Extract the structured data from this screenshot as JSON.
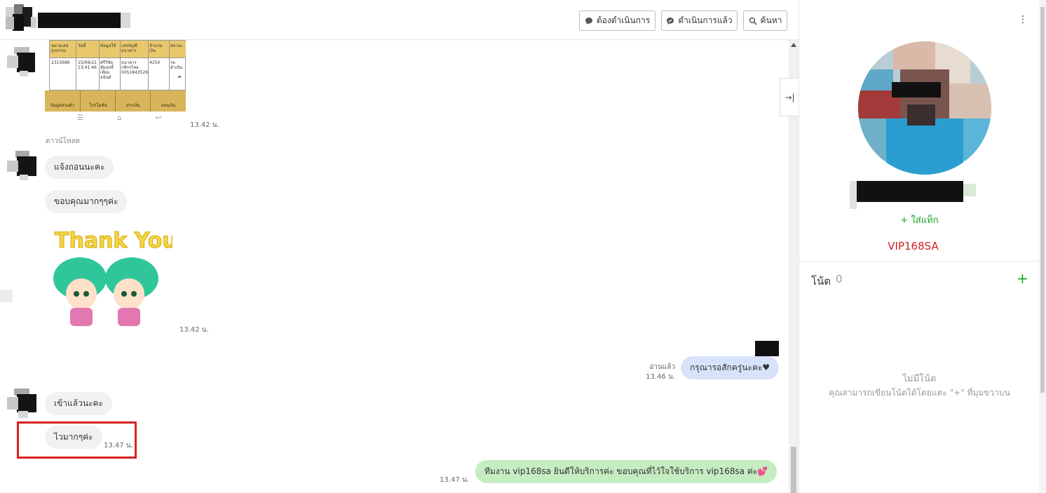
{
  "header": {
    "buttons": {
      "todo_label": "ต้องดำเนินการ",
      "done_label": "ดำเนินการแล้ว",
      "search_label": "ค้นหา"
    }
  },
  "chat": {
    "download_label": "ดาวน์โหลด",
    "screenshot_table": {
      "header_cells": [
        "หมายเลขธุรกรรม",
        "วันที่",
        "ข้อมูลใช้",
        "เลขบัญชีธนาคาร",
        "จำนวนเงิน",
        "สถานะ"
      ],
      "row_cells": [
        "2315686",
        "15/06/21 13:41:46",
        "ศรีวิชัย สัมฤทธิ์ เที่ยม อนันต์",
        "ธนาคาร กสิกรไทย 0051843526",
        "4250",
        "รอดำเนิน"
      ],
      "bottom_bar": [
        "ข้อมูลส่วนตัว",
        "โปรโมชั่น",
        "ฝากเงิน",
        "ถอนเงิน"
      ]
    },
    "messages": [
      {
        "id": "m1",
        "side": "left",
        "type": "image",
        "time": "13.42 น."
      },
      {
        "id": "m2",
        "side": "left",
        "type": "text",
        "text": "แจ้งถอนนะคะ"
      },
      {
        "id": "m3",
        "side": "left",
        "type": "text",
        "text": "ขอบคุณมากๆๆค่ะ"
      },
      {
        "id": "m4",
        "side": "left",
        "type": "sticker",
        "sticker_text": "Thank You",
        "time": "13.42 น."
      },
      {
        "id": "m5",
        "side": "right",
        "type": "text",
        "text": "กรุณารอสักครู่นะคะ♥",
        "read": "อ่านแล้ว",
        "time": "13.46 น."
      },
      {
        "id": "m6",
        "side": "left",
        "type": "text",
        "text": "เข้าแล้วนะคะ"
      },
      {
        "id": "m7",
        "side": "left",
        "type": "text",
        "text": "ไวมากๆค่ะ",
        "time": "13.47 น."
      },
      {
        "id": "m8",
        "side": "right",
        "type": "text",
        "text": "ทีมงาน vip168sa ยินดีให้บริการค่ะ ขอบคุณที่ไว้ใจใช้บริการ vip168sa ค่ะ💕",
        "time": "13.47 น."
      }
    ]
  },
  "profile": {
    "add_tag_label": "+ ใส่แท็ก",
    "tag": "VIP168SA",
    "notes": {
      "title": "โน้ต",
      "count": "0",
      "empty_title": "ไม่มีโน้ต",
      "empty_hint": "คุณสามารถเขียนโน้ตได้โดยแตะ \"+\" ที่มุมขวาบน"
    }
  },
  "colors": {
    "bubble_left": "#f1f1f1",
    "bubble_right_blue": "#d7e2fb",
    "bubble_right_green": "#c6ecc1",
    "accent_green": "#1aa321",
    "tag_red": "#d12020",
    "highlight_red": "#dd1f1f"
  },
  "icons": [
    "chat-bubble-icon",
    "chat-bubble-check-icon",
    "search-icon",
    "collapse-panel-icon",
    "more-vertical-icon",
    "add-icon"
  ]
}
